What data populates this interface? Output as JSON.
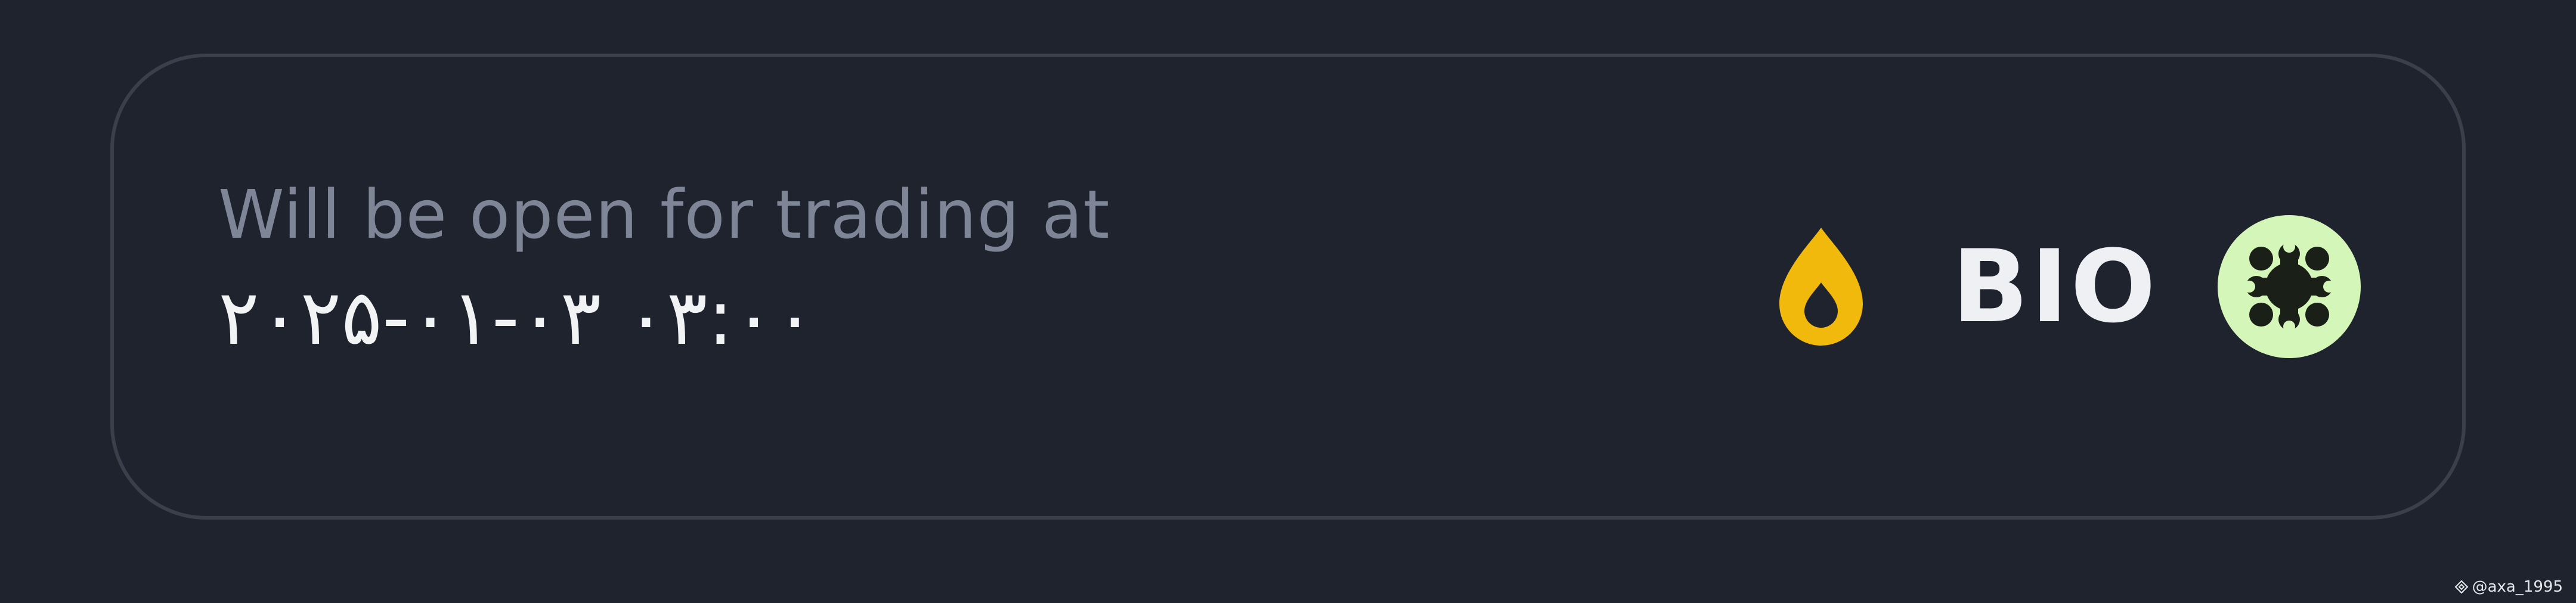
{
  "listing": {
    "subtitle": "Will be open for trading at",
    "datetime": "۲۰۲۵-۰۱-۰۳ ۰۳:۰۰"
  },
  "token": {
    "symbol": "BIO",
    "logo_icon": "bio-logo-icon",
    "badge_icon": "drop-icon"
  },
  "watermark": {
    "text": "@axa_1995",
    "icon": "binance-icon"
  },
  "colors": {
    "background": "#1f232e",
    "card_border": "#3a3f4b",
    "subtitle": "#7e8596",
    "text": "#f2f3f5",
    "drop_icon": "#f0b90b",
    "token_logo_bg": "#d4f6b8",
    "token_logo_fg": "#1a1f17"
  }
}
